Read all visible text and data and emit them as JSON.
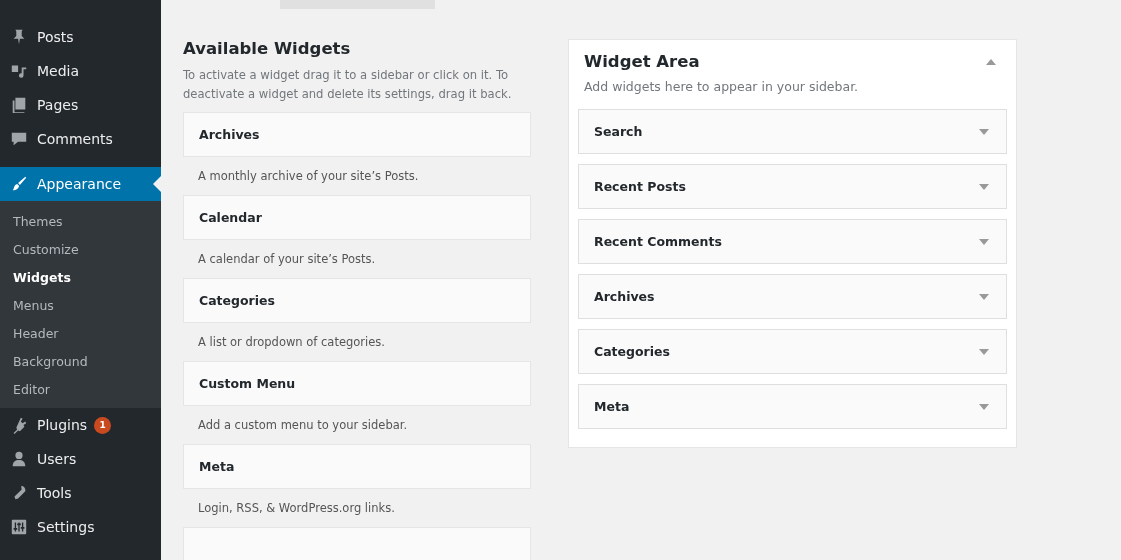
{
  "menu": {
    "items": [
      {
        "label": "Posts",
        "selected": false
      },
      {
        "label": "Media",
        "selected": false
      },
      {
        "label": "Pages",
        "selected": false
      },
      {
        "label": "Comments",
        "selected": false
      },
      {
        "label": "Appearance",
        "selected": true,
        "children": [
          {
            "label": "Themes",
            "selected": false
          },
          {
            "label": "Customize",
            "selected": false
          },
          {
            "label": "Widgets",
            "selected": true
          },
          {
            "label": "Menus",
            "selected": false
          },
          {
            "label": "Header",
            "selected": false
          },
          {
            "label": "Background",
            "selected": false
          },
          {
            "label": "Editor",
            "selected": false
          }
        ]
      },
      {
        "label": "Plugins",
        "selected": false,
        "badge": "1"
      },
      {
        "label": "Users",
        "selected": false
      },
      {
        "label": "Tools",
        "selected": false
      },
      {
        "label": "Settings",
        "selected": false
      }
    ]
  },
  "available": {
    "title": "Available Widgets",
    "description": "To activate a widget drag it to a sidebar or click on it. To deactivate a widget and delete its settings, drag it back.",
    "widgets": [
      {
        "name": "Archives",
        "description": "A monthly archive of your site’s Posts."
      },
      {
        "name": "Calendar",
        "description": "A calendar of your site’s Posts."
      },
      {
        "name": "Categories",
        "description": "A list or dropdown of categories."
      },
      {
        "name": "Custom Menu",
        "description": "Add a custom menu to your sidebar."
      },
      {
        "name": "Meta",
        "description": "Login, RSS, & WordPress.org links."
      }
    ]
  },
  "area": {
    "title": "Widget Area",
    "expanded": true,
    "description": "Add widgets here to appear in your sidebar.",
    "widgets": [
      {
        "name": "Search",
        "expanded": false
      },
      {
        "name": "Recent Posts",
        "expanded": false
      },
      {
        "name": "Recent Comments",
        "expanded": false
      },
      {
        "name": "Archives",
        "expanded": false
      },
      {
        "name": "Categories",
        "expanded": false
      },
      {
        "name": "Meta",
        "expanded": false
      }
    ]
  }
}
